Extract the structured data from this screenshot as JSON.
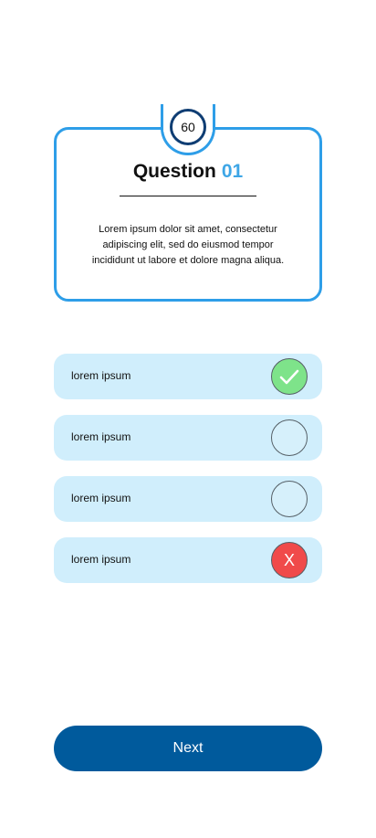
{
  "timer": {
    "value": "60"
  },
  "question": {
    "title_prefix": "Question",
    "number": "01",
    "text": "Lorem ipsum dolor sit amet, consectetur adipiscing elit, sed do eiusmod tempor incididunt ut labore et dolore magna aliqua."
  },
  "options": [
    {
      "label": "lorem ipsum",
      "state": "correct",
      "icon": "check-icon"
    },
    {
      "label": "lorem ipsum",
      "state": "unselected",
      "icon": "empty-circle-icon"
    },
    {
      "label": "lorem ipsum",
      "state": "unselected",
      "icon": "empty-circle-icon"
    },
    {
      "label": "lorem ipsum",
      "state": "wrong",
      "icon": "x-icon",
      "icon_text": "X"
    }
  ],
  "next_button": {
    "label": "Next"
  },
  "colors": {
    "card_border": "#2e9ee8",
    "timer_ring": "#0f3d73",
    "question_number": "#3ea6e6",
    "option_background": "#d0eefc",
    "correct": "#7ee38a",
    "wrong": "#f04a4a",
    "button": "#005a9c"
  }
}
